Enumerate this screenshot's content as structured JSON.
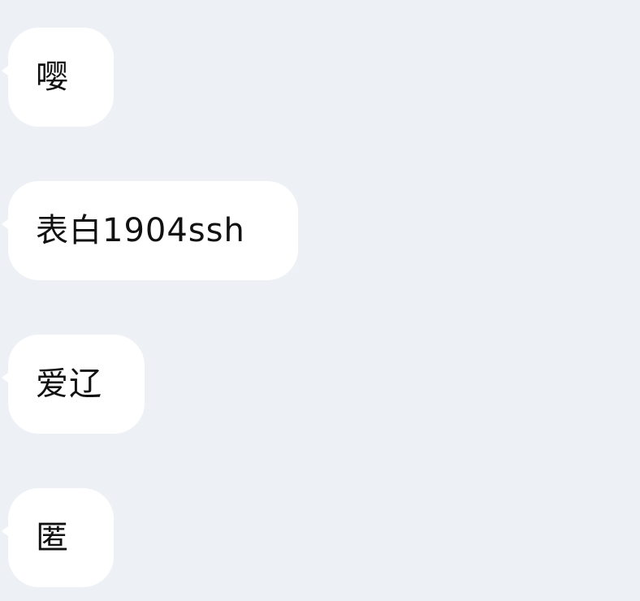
{
  "messages": [
    {
      "text": "嘤"
    },
    {
      "text": "表白1904ssh"
    },
    {
      "text": "爱辽"
    },
    {
      "text": "匿"
    }
  ],
  "colors": {
    "background": "#edf1f5",
    "bubble": "#ffffff",
    "text": "#111111"
  }
}
